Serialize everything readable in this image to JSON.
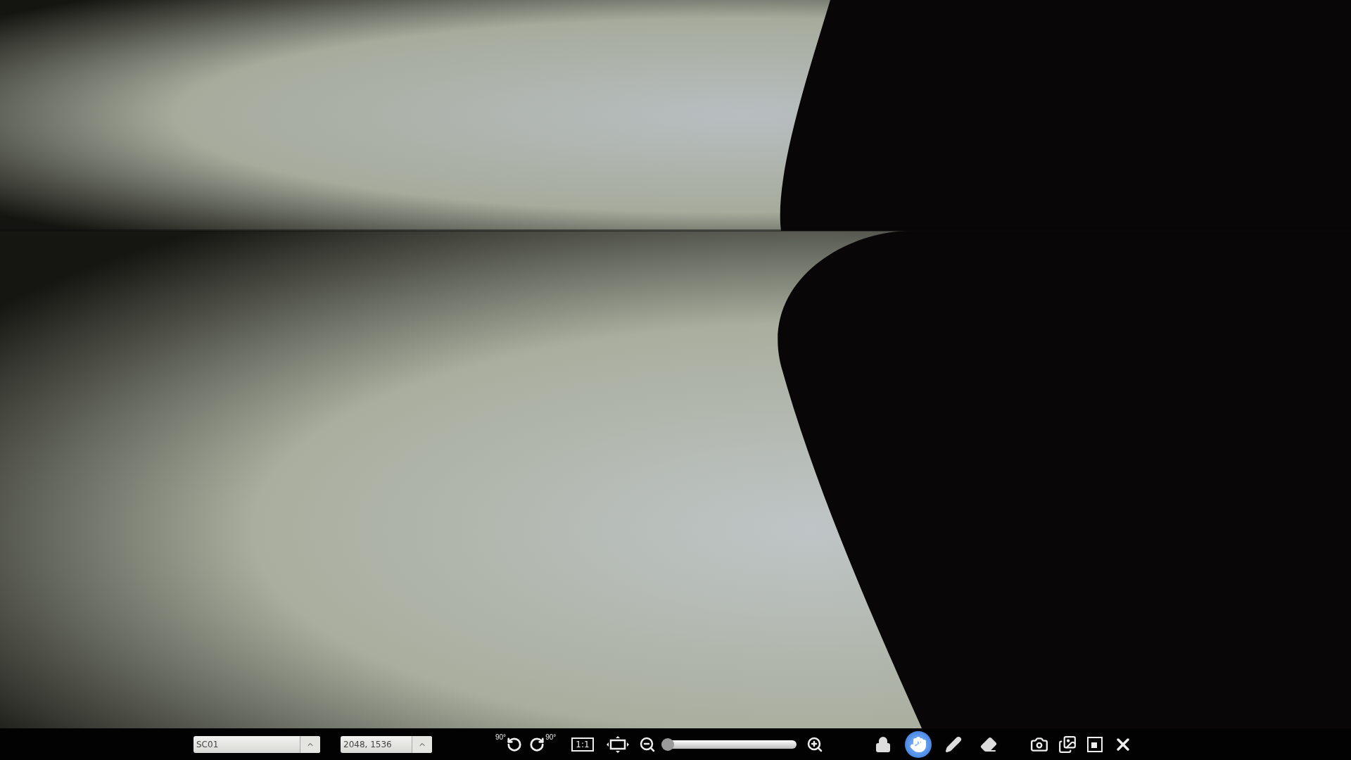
{
  "toolbar": {
    "camera_select": {
      "value": "SC01"
    },
    "resolution_select": {
      "value": "2048, 1536"
    },
    "rotate_left": {
      "label": "90°"
    },
    "rotate_right": {
      "label": "90°"
    },
    "actual_size": {
      "label": "1:1"
    },
    "zoom": {
      "level": 0.04
    },
    "tools": [
      {
        "kind": "lock",
        "selected": false
      },
      {
        "kind": "hand",
        "selected": true
      },
      {
        "kind": "pencil",
        "selected": false
      },
      {
        "kind": "eraser",
        "selected": false
      }
    ]
  }
}
